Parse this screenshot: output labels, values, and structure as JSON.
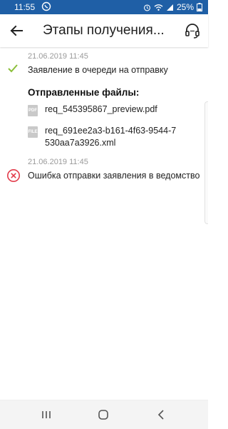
{
  "status_bar": {
    "time": "11:55",
    "battery": "25%"
  },
  "header": {
    "title": "Этапы получения..."
  },
  "entries": [
    {
      "date": "21.06.2019 11:45",
      "text": "Заявление в очереди на отправку"
    },
    {
      "date": "21.06.2019 11:45",
      "text": "Ошибка отправки заявления в ведомство"
    }
  ],
  "files": {
    "title": "Отправленные файлы:",
    "items": [
      {
        "icon_label": "PDF",
        "name": "req_545395867_preview.pdf"
      },
      {
        "icon_label": "FILE",
        "name": "req_691ee2a3-b161-4f63-9544-7530aa7a3926.xml"
      }
    ]
  },
  "colors": {
    "status_bar": "#1f5fa6",
    "success": "#8bbf3a",
    "error": "#e23b4a"
  }
}
